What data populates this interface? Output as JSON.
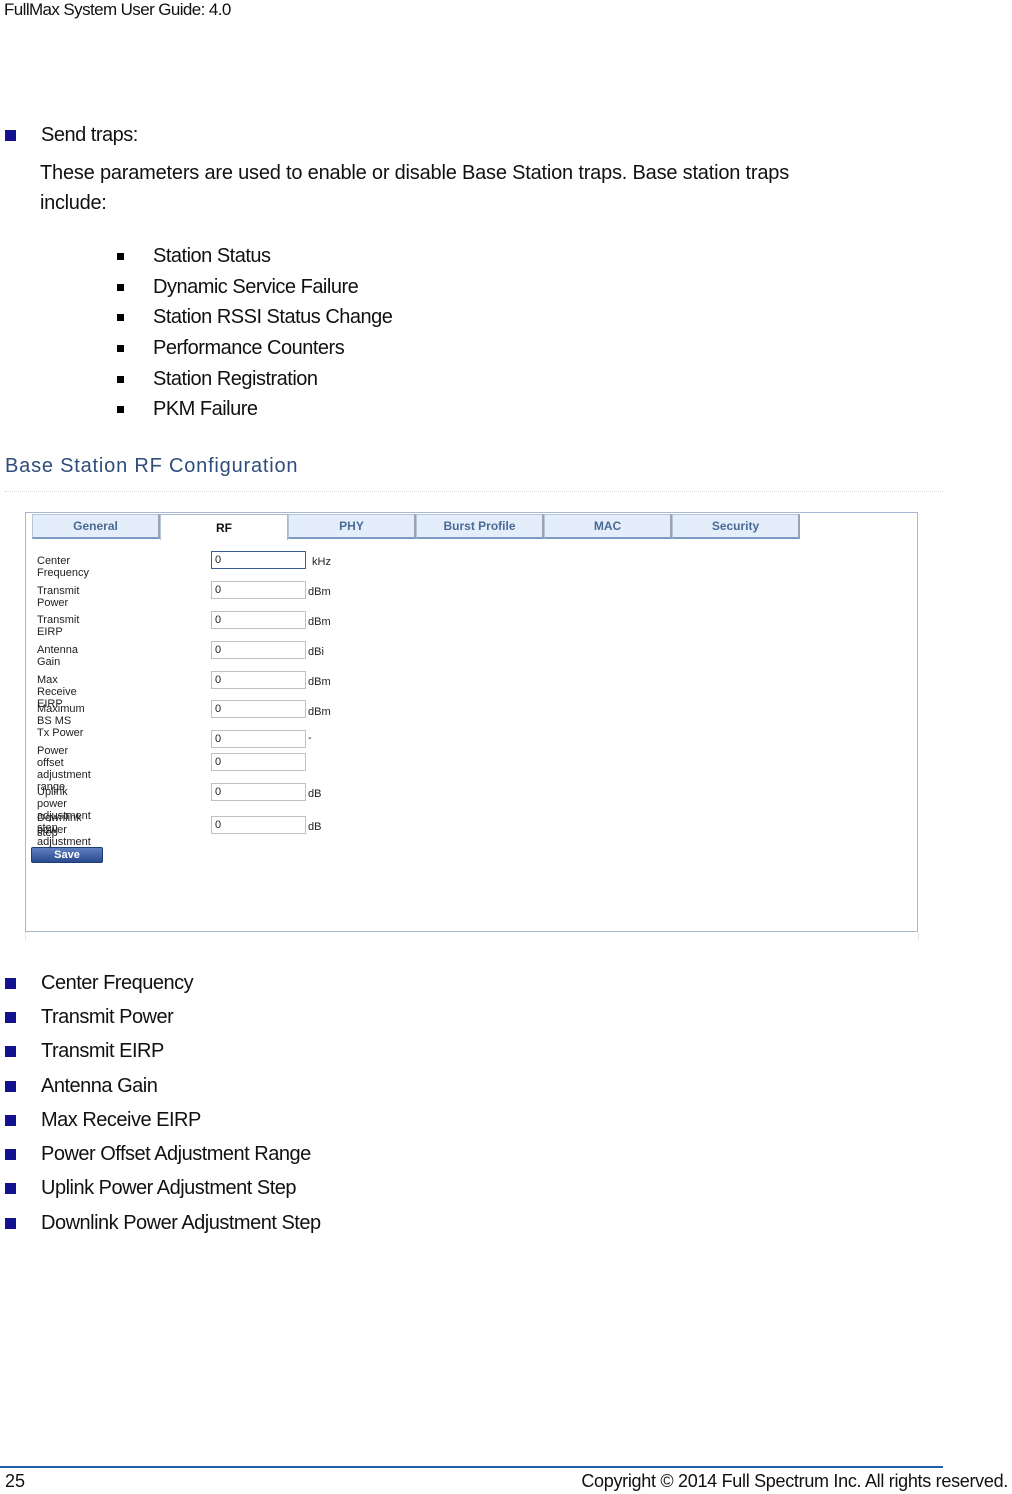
{
  "header": {
    "title": "FullMax System User Guide: 4.0"
  },
  "send_traps": {
    "label": "Send traps:",
    "description_line1": "These parameters are used to enable or disable Base Station traps.  Base station traps",
    "description_line2": "include:",
    "items": [
      "Station Status",
      "Dynamic Service Failure",
      "Station RSSI Status Change",
      "Performance Counters",
      "Station Registration",
      "PKM Failure"
    ]
  },
  "section": {
    "heading": "Base Station RF Configuration"
  },
  "ui_screenshot": {
    "tabs": [
      {
        "label": "General",
        "active": false
      },
      {
        "label": "RF",
        "active": true
      },
      {
        "label": "PHY",
        "active": false
      },
      {
        "label": "Burst Profile",
        "active": false
      },
      {
        "label": "MAC",
        "active": false
      },
      {
        "label": "Security",
        "active": false
      }
    ],
    "fields": [
      {
        "label": "Center Frequency",
        "value": "0",
        "unit": "kHz"
      },
      {
        "label": "Transmit Power",
        "value": "0",
        "unit": "dBm"
      },
      {
        "label": "Transmit EIRP",
        "value": "0",
        "unit": "dBm"
      },
      {
        "label": "Antenna Gain",
        "value": "0",
        "unit": "dBi"
      },
      {
        "label": "Max Receive EIRP",
        "value": "0",
        "unit": "dBm"
      },
      {
        "label": "Maximum BS MS Tx Power",
        "value": "0",
        "unit": "dBm"
      },
      {
        "label": "Power offset adjustment range",
        "value_min": "0",
        "value_max": "0",
        "unit": "-"
      },
      {
        "label": "Uplink power adjustment step",
        "value": "0",
        "unit": "dB"
      },
      {
        "label_line1": "Downlink power adjustment",
        "label_line2": "step",
        "value": "0",
        "unit": "dB"
      }
    ],
    "save_label": "Save"
  },
  "parameters": [
    "Center Frequency",
    "Transmit Power",
    "Transmit EIRP",
    "Antenna Gain",
    "Max Receive EIRP",
    "Power Offset Adjustment Range",
    "Uplink Power Adjustment Step",
    "Downlink Power Adjustment Step"
  ],
  "footer": {
    "page_number": "25",
    "copyright": "Copyright © 2014 Full Spectrum Inc. All rights reserved."
  },
  "colors": {
    "bullet_blue": "#12128f",
    "heading_blue": "#2e4d7b",
    "footer_rule": "#1f5fa8",
    "save_button": "#2a4a8f"
  }
}
